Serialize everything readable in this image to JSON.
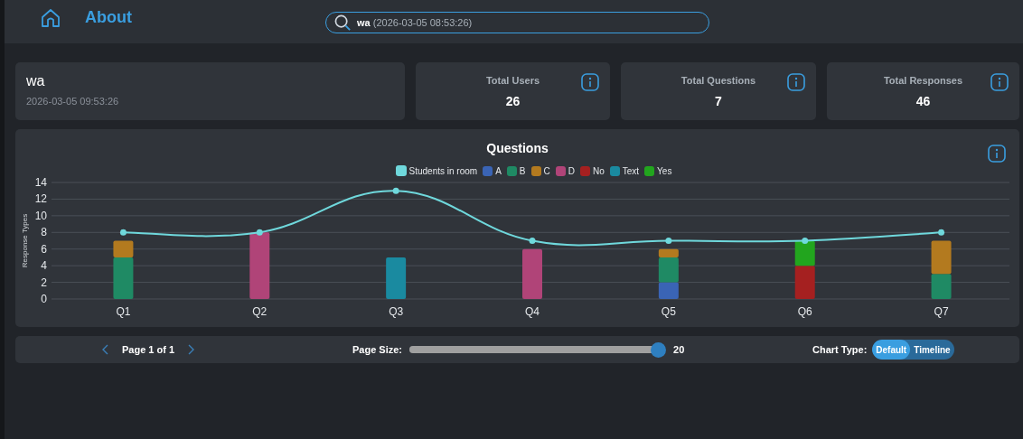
{
  "header": {
    "title": "About",
    "search": {
      "value": "**wa** (2026-03-05 08:53:26)"
    }
  },
  "session": {
    "name": "wa",
    "timestamp": "2026-03-05 09:53:26"
  },
  "stats": [
    {
      "label": "Total Users",
      "value": "26"
    },
    {
      "label": "Total Questions",
      "value": "7"
    },
    {
      "label": "Total Responses",
      "value": "46"
    }
  ],
  "chart": {
    "title": "Questions",
    "chart_data": {
      "type": "bar",
      "stacked": true,
      "grid": true,
      "ylabel": "Response Types",
      "categories": [
        "Q1",
        "Q2",
        "Q3",
        "Q4",
        "Q5",
        "Q6",
        "Q7"
      ],
      "ylim": [
        0,
        14
      ],
      "yticks": [
        0,
        2,
        4,
        6,
        8,
        10,
        12,
        14
      ],
      "series": [
        {
          "name": "Students in room",
          "type": "line",
          "marker": "circle",
          "color": "#6fd8dc",
          "values": [
            8,
            8,
            13,
            7,
            7,
            7,
            8
          ]
        },
        {
          "name": "A",
          "color": "#3a64b5",
          "values": [
            0,
            0,
            0,
            0,
            2,
            0,
            0
          ]
        },
        {
          "name": "B",
          "color": "#1f8a64",
          "values": [
            5,
            0,
            0,
            0,
            3,
            0,
            3
          ]
        },
        {
          "name": "C",
          "color": "#b37a1f",
          "values": [
            2,
            0,
            0,
            0,
            1,
            0,
            4
          ]
        },
        {
          "name": "D",
          "color": "#b04478",
          "values": [
            0,
            8,
            0,
            6,
            0,
            0,
            0
          ]
        },
        {
          "name": "No",
          "color": "#a52020",
          "values": [
            0,
            0,
            0,
            0,
            0,
            4,
            0
          ]
        },
        {
          "name": "Text",
          "color": "#1a8aa0",
          "values": [
            0,
            0,
            5,
            0,
            0,
            0,
            0
          ]
        },
        {
          "name": "Yes",
          "color": "#22a51e",
          "values": [
            0,
            0,
            0,
            0,
            0,
            3,
            0
          ]
        }
      ]
    }
  },
  "footer": {
    "page_label": "Page 1 of 1",
    "page_size": {
      "label": "Page Size:",
      "level": 1,
      "value": "20"
    },
    "chart_type": {
      "label": "Chart Type:",
      "options": [
        {
          "label": "Default",
          "selected": true
        },
        {
          "label": "Timeline",
          "selected": false
        }
      ]
    }
  }
}
